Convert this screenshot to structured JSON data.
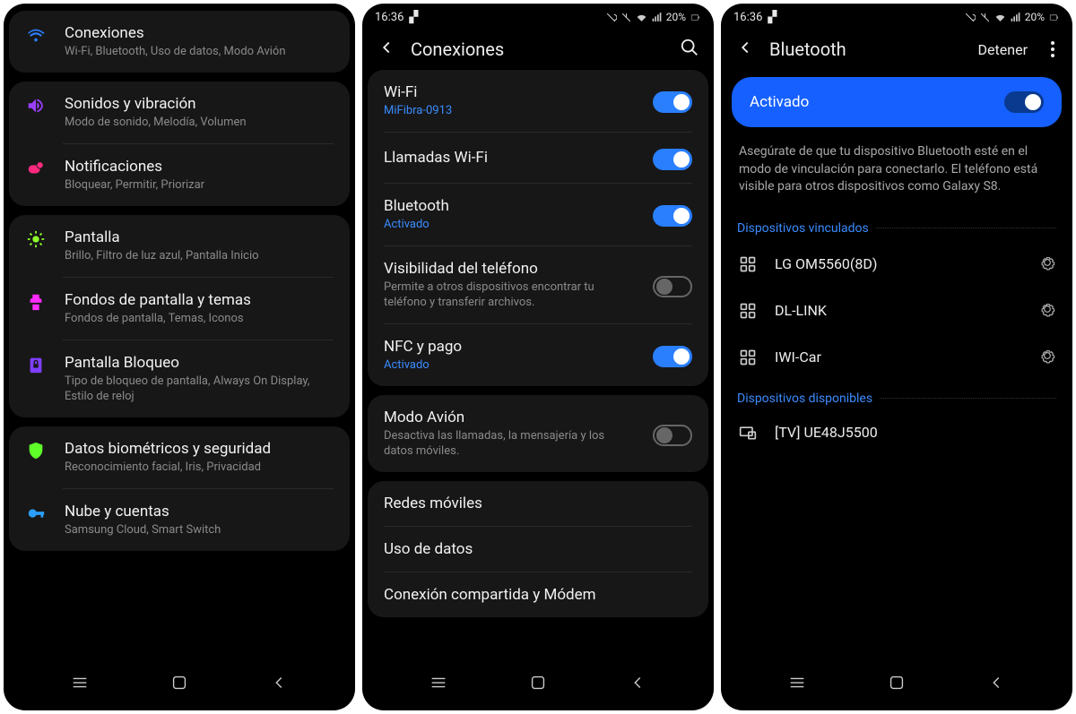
{
  "status": {
    "time": "16:36",
    "battery": "20%"
  },
  "screen1": {
    "items": [
      {
        "icon": "wifi",
        "color": "#2a7fff",
        "title": "Conexiones",
        "sub": "Wi-Fi, Bluetooth, Uso de datos, Modo Avión"
      },
      {
        "icon": "sound",
        "color": "#9b3fff",
        "title": "Sonidos y vibración",
        "sub": "Modo de sonido, Melodía, Volumen"
      },
      {
        "icon": "notif",
        "color": "#ff2a7f",
        "title": "Notificaciones",
        "sub": "Bloquear, Permitir, Priorizar"
      },
      {
        "icon": "display",
        "color": "#8fff2a",
        "title": "Pantalla",
        "sub": "Brillo, Filtro de luz azul, Pantalla Inicio"
      },
      {
        "icon": "wallpaper",
        "color": "#ff2aff",
        "title": "Fondos de pantalla y temas",
        "sub": "Fondos de pantalla, Temas, Iconos"
      },
      {
        "icon": "lock",
        "color": "#7f3fff",
        "title": "Pantalla Bloqueo",
        "sub": "Tipo de bloqueo de pantalla, Always On Display, Estilo de reloj"
      },
      {
        "icon": "shield",
        "color": "#5fff2a",
        "title": "Datos biométricos y seguridad",
        "sub": "Reconocimiento facial, Iris, Privacidad"
      },
      {
        "icon": "cloud",
        "color": "#2a9fff",
        "title": "Nube y cuentas",
        "sub": "Samsung Cloud, Smart Switch"
      }
    ]
  },
  "screen2": {
    "header": "Conexiones",
    "groups": [
      [
        {
          "title": "Wi-Fi",
          "sub": "MiFibra-0913",
          "subBlue": true,
          "toggle": "on"
        },
        {
          "title": "Llamadas Wi-Fi",
          "toggle": "on"
        },
        {
          "title": "Bluetooth",
          "sub": "Activado",
          "subBlue": true,
          "toggle": "on"
        },
        {
          "title": "Visibilidad del teléfono",
          "sub": "Permite a otros dispositivos encontrar tu teléfono y transferir archivos.",
          "toggle": "off"
        },
        {
          "title": "NFC y pago",
          "sub": "Activado",
          "subBlue": true,
          "toggle": "on"
        }
      ],
      [
        {
          "title": "Modo Avión",
          "sub": "Desactiva las llamadas, la mensajería y los datos móviles.",
          "toggle": "off"
        }
      ],
      [
        {
          "title": "Redes móviles"
        },
        {
          "title": "Uso de datos"
        },
        {
          "title": "Conexión compartida y Módem"
        }
      ]
    ]
  },
  "screen3": {
    "header": "Bluetooth",
    "action": "Detener",
    "banner": "Activado",
    "info": "Asegúrate de que tu dispositivo Bluetooth esté en el modo de vinculación para conectarlo. El teléfono está visible para otros dispositivos como Galaxy S8.",
    "section_paired": "Dispositivos vinculados",
    "paired": [
      "LG OM5560(8D)",
      "DL-LINK",
      "IWI-Car"
    ],
    "section_avail": "Dispositivos disponibles",
    "available": [
      "[TV] UE48J5500"
    ]
  }
}
